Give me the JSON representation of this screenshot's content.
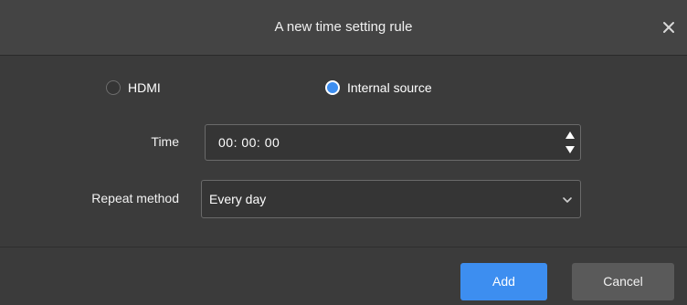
{
  "dialog": {
    "title": "A new time setting rule",
    "close_icon": "close-icon"
  },
  "source": {
    "options": [
      {
        "label": "HDMI",
        "checked": false
      },
      {
        "label": "Internal source",
        "checked": true
      }
    ]
  },
  "time": {
    "label": "Time",
    "value": "00: 00: 00",
    "stepper_icons": [
      "triangle-up-icon",
      "triangle-down-icon"
    ]
  },
  "repeat": {
    "label": "Repeat method",
    "selected": "Every day",
    "icon": "chevron-down-icon"
  },
  "footer": {
    "add_label": "Add",
    "cancel_label": "Cancel"
  },
  "colors": {
    "accent": "#3d8ef0",
    "background": "#3b3b3b",
    "titlebar": "#444444"
  }
}
